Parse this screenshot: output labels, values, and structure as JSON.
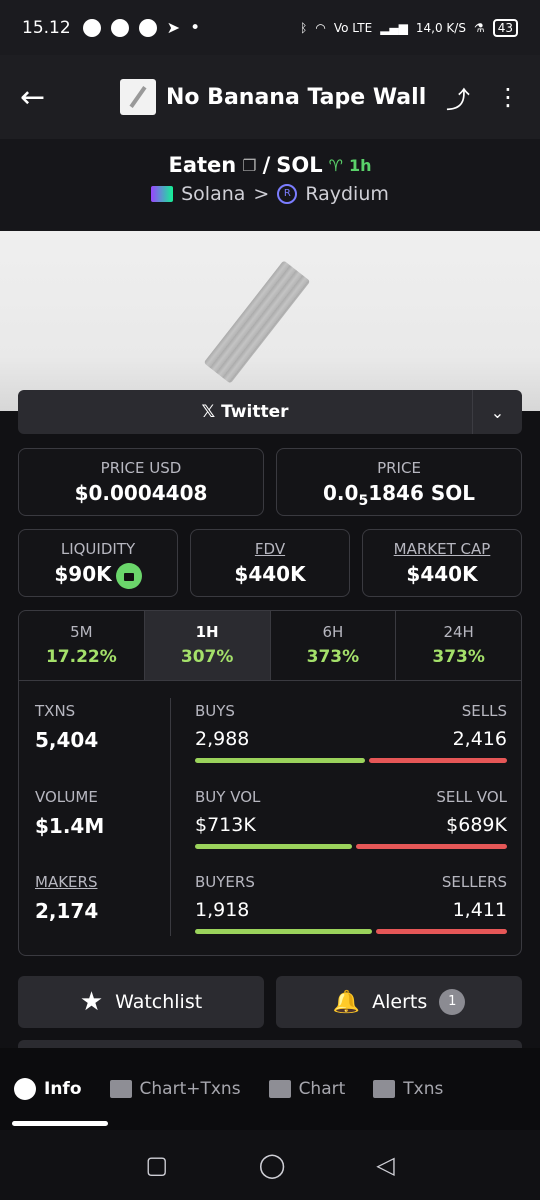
{
  "status": {
    "time": "15.12",
    "indicator": "•",
    "net": "Vo LTE",
    "speed": "14,0 K/S",
    "battery": "43"
  },
  "header": {
    "token_name": "No Banana Tape Wall"
  },
  "pair": {
    "base": "Eaten",
    "sep": "/",
    "quote": "SOL",
    "age": "1h",
    "chain": "Solana",
    "arrow": ">",
    "dex": "Raydium"
  },
  "links": {
    "twitter": "𝕏 Twitter"
  },
  "price": {
    "usd_label": "PRICE USD",
    "usd_value": "$0.0004408",
    "native_label": "PRICE",
    "native_prefix": "0.0",
    "native_sub": "5",
    "native_rest": "1846 SOL"
  },
  "metrics": {
    "liquidity_label": "LIQUIDITY",
    "liquidity_value": "$90K",
    "fdv_label": "FDV",
    "fdv_value": "$440K",
    "mcap_label": "MARKET CAP",
    "mcap_value": "$440K"
  },
  "periods": [
    {
      "label": "5M",
      "change": "17.22%"
    },
    {
      "label": "1H",
      "change": "307%"
    },
    {
      "label": "6H",
      "change": "373%"
    },
    {
      "label": "24H",
      "change": "373%"
    }
  ],
  "stats": {
    "txns_label": "TXNS",
    "txns_value": "5,404",
    "buys_label": "BUYS",
    "buys_value": "2,988",
    "sells_label": "SELLS",
    "sells_value": "2,416",
    "volume_label": "VOLUME",
    "volume_value": "$1.4M",
    "buyvol_label": "BUY VOL",
    "buyvol_value": "$713K",
    "sellvol_label": "SELL VOL",
    "sellvol_value": "$689K",
    "makers_label": "MAKERS",
    "makers_value": "2,174",
    "buyers_label": "BUYERS",
    "buyers_value": "1,918",
    "sellers_label": "SELLERS",
    "sellers_value": "1,411"
  },
  "actions": {
    "watchlist": "Watchlist",
    "alerts": "Alerts",
    "alerts_count": "1"
  },
  "nav": {
    "info": "Info",
    "chart_txns": "Chart+Txns",
    "chart": "Chart",
    "txns": "Txns"
  },
  "colors": {
    "buy": "#9bd35c",
    "sell": "#e65757",
    "positive": "#a4e06a"
  }
}
